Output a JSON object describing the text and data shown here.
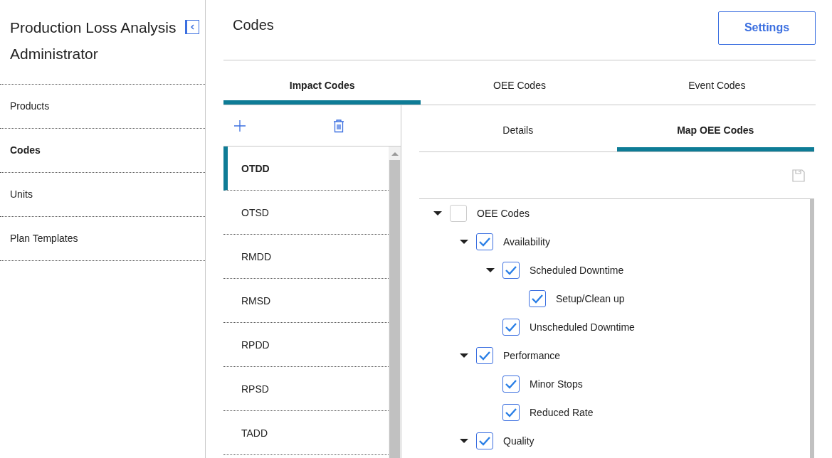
{
  "sidebar": {
    "title": "Production Loss Analysis Administrator",
    "items": [
      {
        "label": "Products",
        "selected": false
      },
      {
        "label": "Codes",
        "selected": true
      },
      {
        "label": "Units",
        "selected": false
      },
      {
        "label": "Plan Templates",
        "selected": false
      }
    ]
  },
  "header": {
    "title": "Codes",
    "button": "Settings"
  },
  "tabs": [
    {
      "label": "Impact Codes",
      "selected": true
    },
    {
      "label": "OEE Codes",
      "selected": false
    },
    {
      "label": "Event Codes",
      "selected": false
    }
  ],
  "codes": [
    {
      "label": "OTDD",
      "selected": true
    },
    {
      "label": "OTSD",
      "selected": false
    },
    {
      "label": "RMDD",
      "selected": false
    },
    {
      "label": "RMSD",
      "selected": false
    },
    {
      "label": "RPDD",
      "selected": false
    },
    {
      "label": "RPSD",
      "selected": false
    },
    {
      "label": "TADD",
      "selected": false
    }
  ],
  "detail_tabs": [
    {
      "label": "Details",
      "selected": false
    },
    {
      "label": "Map OEE Codes",
      "selected": true
    }
  ],
  "tree": [
    {
      "label": "OEE Codes",
      "checked": false,
      "expanded": true,
      "children": [
        {
          "label": "Availability",
          "checked": true,
          "expanded": true,
          "children": [
            {
              "label": "Scheduled Downtime",
              "checked": true,
              "expanded": true,
              "children": [
                {
                  "label": "Setup/Clean up",
                  "checked": true
                }
              ]
            },
            {
              "label": "Unscheduled Downtime",
              "checked": true
            }
          ]
        },
        {
          "label": "Performance",
          "checked": true,
          "expanded": true,
          "children": [
            {
              "label": "Minor Stops",
              "checked": true
            },
            {
              "label": "Reduced Rate",
              "checked": true
            }
          ]
        },
        {
          "label": "Quality",
          "checked": true,
          "expanded": true
        }
      ]
    }
  ]
}
